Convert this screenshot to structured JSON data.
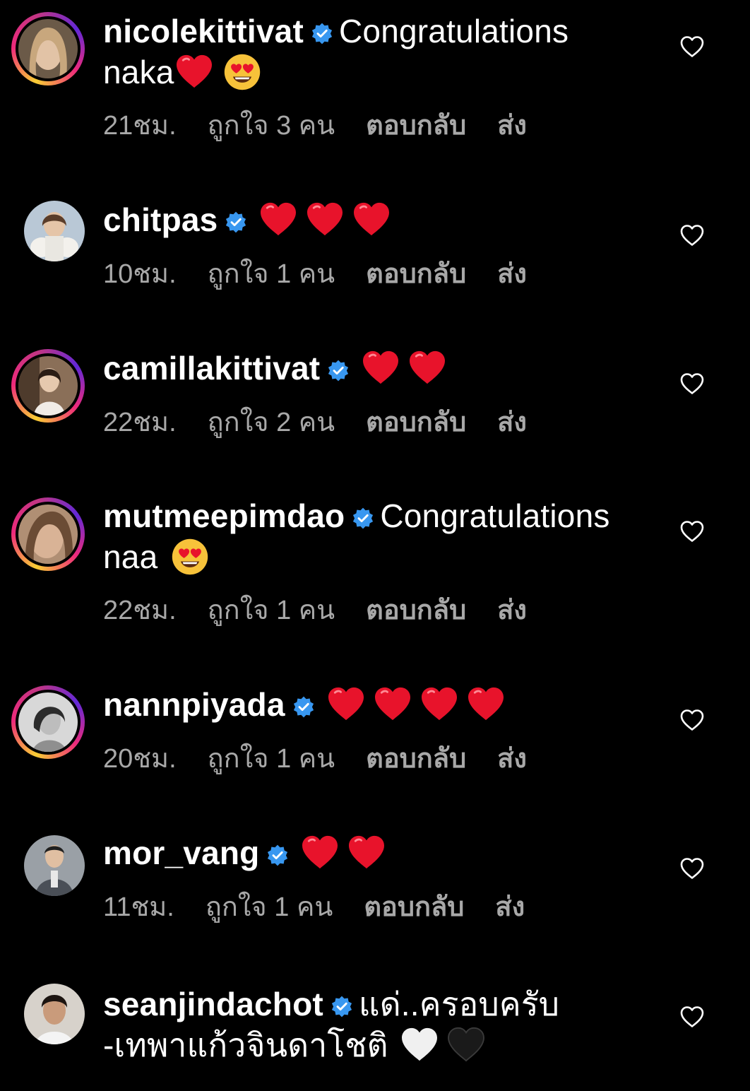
{
  "comments": [
    {
      "username": "nicolekittivat",
      "text_line1": "Congratulations",
      "text_line2": "naka",
      "time": "21ชม.",
      "likes": "ถูกใจ 3 คน",
      "reply": "ตอบกลับ",
      "send": "ส่ง"
    },
    {
      "username": "chitpas",
      "time": "10ชม.",
      "likes": "ถูกใจ 1 คน",
      "reply": "ตอบกลับ",
      "send": "ส่ง"
    },
    {
      "username": "camillakittivat",
      "time": "22ชม.",
      "likes": "ถูกใจ 2 คน",
      "reply": "ตอบกลับ",
      "send": "ส่ง"
    },
    {
      "username": "mutmeepimdao",
      "text_line1": "Congratulations",
      "text_line2": "naa",
      "time": "22ชม.",
      "likes": "ถูกใจ 1 คน",
      "reply": "ตอบกลับ",
      "send": "ส่ง"
    },
    {
      "username": "nannpiyada",
      "time": "20ชม.",
      "likes": "ถูกใจ 1 คน",
      "reply": "ตอบกลับ",
      "send": "ส่ง"
    },
    {
      "username": "mor_vang",
      "time": "11ชม.",
      "likes": "ถูกใจ 1 คน",
      "reply": "ตอบกลับ",
      "send": "ส่ง"
    },
    {
      "username": "seanjindachot",
      "text_line1": "แด่..ครอบครับ",
      "text_line2": "-เทพาแก้วจินดาโชติ"
    }
  ],
  "icons": {
    "verified": "verified-badge-icon",
    "like": "heart-outline-icon",
    "emoji_red_heart": "red-heart-emoji",
    "emoji_heart_eyes": "heart-eyes-emoji",
    "emoji_white_heart": "white-heart-emoji",
    "emoji_black_heart": "black-heart-emoji"
  },
  "colors": {
    "background": "#000000",
    "text": "#ffffff",
    "meta_text": "#a8a8a8",
    "verified": "#3897f0",
    "heart_red": "#e8132b"
  }
}
